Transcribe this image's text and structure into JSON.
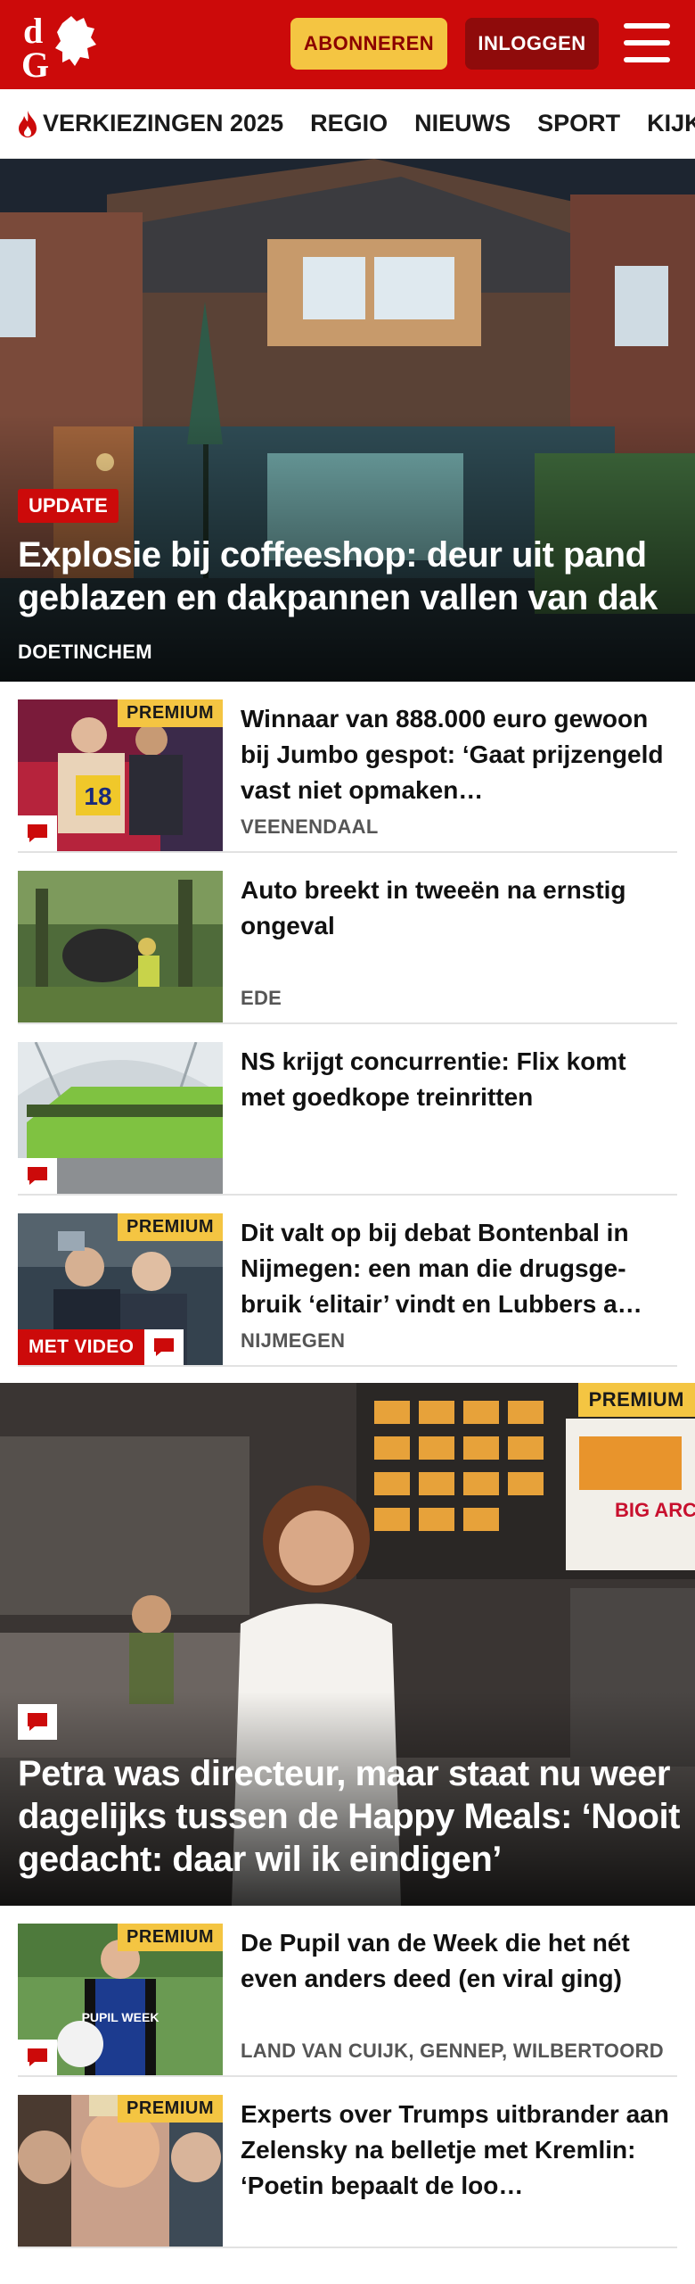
{
  "header": {
    "logo_text": "dG",
    "subscribe_label": "ABONNEREN",
    "login_label": "INLOGGEN"
  },
  "nav": {
    "items": [
      "VERKIEZINGEN 2025",
      "REGIO",
      "NIEUWS",
      "SPORT",
      "KIJK"
    ]
  },
  "hero": {
    "badge": "UPDATE",
    "title": "Explosie bij coffeeshop: deur uit pand geblazen en dakpannen vallen van dak",
    "location": "DOETINCHEM"
  },
  "articles": [
    {
      "title": "Winnaar van 888.000 euro gewoon bij Jumbo gespot: ‘Gaat prijzengeld vast niet opmaken…",
      "location": "VEENENDAAL",
      "premium": "PREMIUM",
      "thumb_number": "18"
    },
    {
      "title": "Auto breekt in tweeën na ernstig ongeval",
      "location": "EDE"
    },
    {
      "title": "NS krijgt concurrentie: Flix komt met goedkope treinritten",
      "location": ""
    },
    {
      "title": "Dit valt op bij debat Bontenbal in Nijmegen: een man die drugsge-bruik ‘elitair’ vindt en Lubbers a…",
      "location": "NIJMEGEN",
      "premium": "PREMIUM",
      "video": "MET VIDEO"
    }
  ],
  "feature": {
    "premium": "PREMIUM",
    "title": "Petra was directeur, maar staat nu weer dagelijks tussen de Happy Meals: ‘Nooit gedacht: daar wil ik eindigen’",
    "sign_text": "BIG ARCH"
  },
  "articles2": [
    {
      "title": "De Pupil van de Week die het nét even anders deed (en viral ging)",
      "location": "LAND VAN CUIJK, GENNEP, WILBERTOORD",
      "premium": "PREMIUM",
      "shirt_text": "PUPIL WEEK"
    },
    {
      "title": "Experts over Trumps uitbrander aan Zelensky na belletje met Kremlin: ‘Poetin bepaalt de loo…",
      "location": "",
      "premium": "PREMIUM"
    }
  ],
  "colors": {
    "brand_red": "#cc0a0a",
    "premium_yellow": "#f4c542",
    "login_dark_red": "#8f0b0b"
  }
}
